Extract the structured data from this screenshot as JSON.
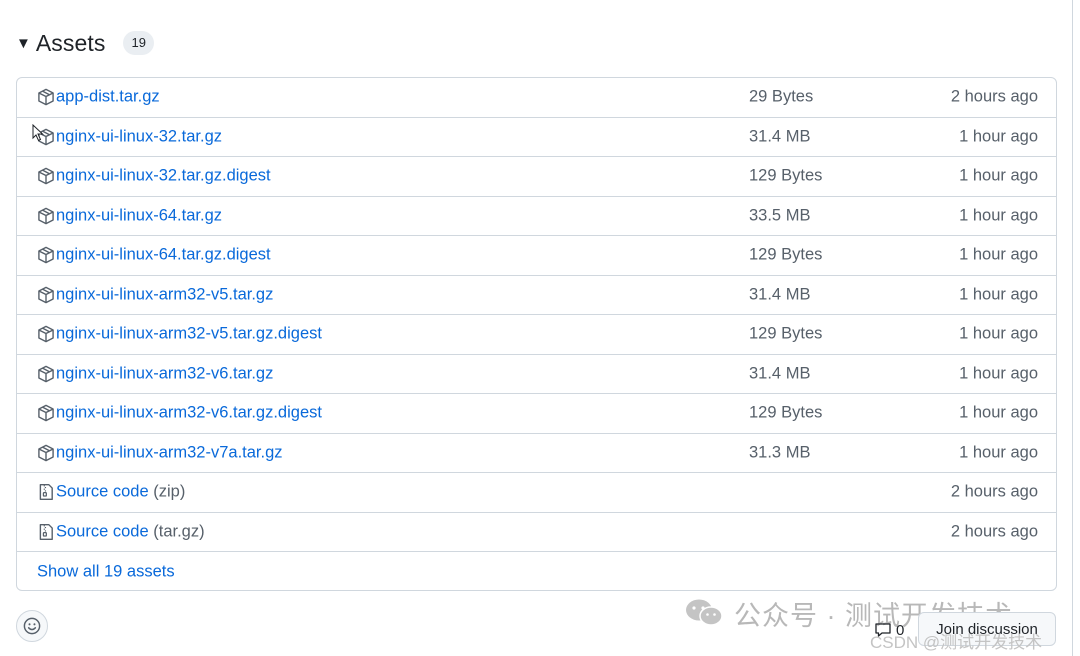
{
  "assets": {
    "title": "Assets",
    "count": "19",
    "rows": [
      {
        "name": "app-dist.tar.gz",
        "suffix": "",
        "size": "29 Bytes",
        "time": "2 hours ago",
        "icon": "package-icon"
      },
      {
        "name": "nginx-ui-linux-32.tar.gz",
        "suffix": "",
        "size": "31.4 MB",
        "time": "1 hour ago",
        "icon": "package-icon"
      },
      {
        "name": "nginx-ui-linux-32.tar.gz.digest",
        "suffix": "",
        "size": "129 Bytes",
        "time": "1 hour ago",
        "icon": "package-icon"
      },
      {
        "name": "nginx-ui-linux-64.tar.gz",
        "suffix": "",
        "size": "33.5 MB",
        "time": "1 hour ago",
        "icon": "package-icon"
      },
      {
        "name": "nginx-ui-linux-64.tar.gz.digest",
        "suffix": "",
        "size": "129 Bytes",
        "time": "1 hour ago",
        "icon": "package-icon"
      },
      {
        "name": "nginx-ui-linux-arm32-v5.tar.gz",
        "suffix": "",
        "size": "31.4 MB",
        "time": "1 hour ago",
        "icon": "package-icon"
      },
      {
        "name": "nginx-ui-linux-arm32-v5.tar.gz.digest",
        "suffix": "",
        "size": "129 Bytes",
        "time": "1 hour ago",
        "icon": "package-icon"
      },
      {
        "name": "nginx-ui-linux-arm32-v6.tar.gz",
        "suffix": "",
        "size": "31.4 MB",
        "time": "1 hour ago",
        "icon": "package-icon"
      },
      {
        "name": "nginx-ui-linux-arm32-v6.tar.gz.digest",
        "suffix": "",
        "size": "129 Bytes",
        "time": "1 hour ago",
        "icon": "package-icon"
      },
      {
        "name": "nginx-ui-linux-arm32-v7a.tar.gz",
        "suffix": "",
        "size": "31.3 MB",
        "time": "1 hour ago",
        "icon": "package-icon"
      },
      {
        "name": "Source code",
        "suffix": " (zip)",
        "size": "",
        "time": "2 hours ago",
        "icon": "file-zip-icon"
      },
      {
        "name": "Source code",
        "suffix": " (tar.gz)",
        "size": "",
        "time": "2 hours ago",
        "icon": "file-zip-icon"
      }
    ],
    "show_all": "Show all 19 assets"
  },
  "footer": {
    "discussion_count": "0",
    "join_label": "Join discussion",
    "reaction_icon": "smiley-icon"
  },
  "watermark": {
    "text": "公众号 · 测试开发技术",
    "csdn": "CSDN @测试开发技术"
  },
  "colors": {
    "link": "#0969da",
    "muted": "#57606a",
    "border": "#d0d7de"
  }
}
